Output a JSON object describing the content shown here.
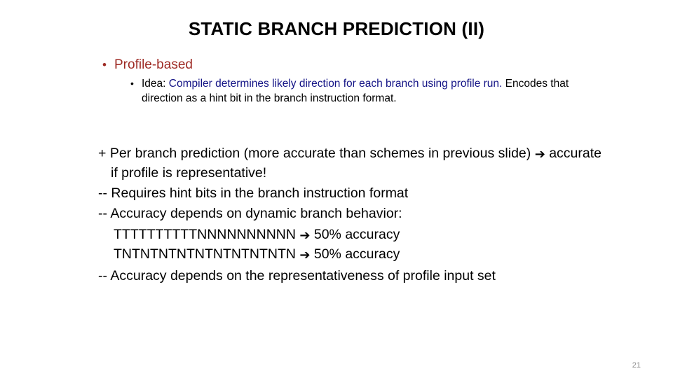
{
  "slide": {
    "title": "STATIC BRANCH PREDICTION (II)",
    "page_number": "21",
    "colors": {
      "heading_red": "#9E2B25",
      "emphasis_blue": "#121285",
      "body_black": "#000000",
      "page_number_gray": "#8c8c8c",
      "background": "#ffffff"
    }
  },
  "content": {
    "bullet_level1": {
      "marker": "•",
      "label": "Profile-based"
    },
    "bullet_level2": {
      "marker": "•",
      "lead": "Idea: ",
      "blue_text": "Compiler determines likely direction for each branch using profile run.",
      "tail_text": " Encodes that direction as a hint bit in the branch instruction format."
    },
    "points": [
      "+ Per branch prediction (more accurate than schemes in previous slide) ➔ accurate if profile is representative!",
      "-- Requires hint bits in the branch instruction format",
      "-- Accuracy depends on dynamic branch behavior:"
    ],
    "point_plus": {
      "sign": "+ ",
      "text_before_arrow": "Per branch prediction (more accurate than schemes in previous slide) ",
      "arrow": "➔",
      "text_after_arrow": " accurate if profile is representative!"
    },
    "point_requires": {
      "sign": "-- ",
      "text": "Requires hint bits in the branch instruction format"
    },
    "point_accuracy_dynamic": {
      "sign": "-- ",
      "text": "Accuracy depends on dynamic branch behavior:"
    },
    "sequences": [
      {
        "pattern": "TTTTTTTTTTNNNNNNNNNN",
        "arrow": "➔",
        "result": " 50% accuracy"
      },
      {
        "pattern": "TNTNTNTNTNTNTNTNTNTN",
        "arrow": "➔",
        "result": " 50% accuracy"
      }
    ],
    "point_accuracy_representative": {
      "sign": "-- ",
      "text": "Accuracy depends on the representativeness of profile input set"
    }
  }
}
